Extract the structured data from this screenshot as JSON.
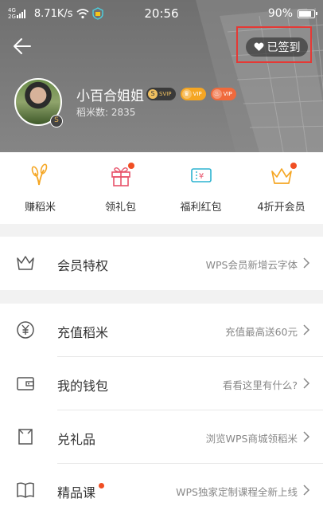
{
  "status_bar": {
    "signal_top": "4G",
    "signal_bottom": "2G",
    "speed": "8.71K/s",
    "time": "20:56",
    "battery": "90%",
    "battery_level": 0.9
  },
  "header": {
    "signin_label": "已签到",
    "username": "小百合姐姐",
    "badges": [
      {
        "glyph": "S",
        "label": "SVIP"
      },
      {
        "glyph": "♛",
        "label": "VIP"
      },
      {
        "glyph": "♨",
        "label": "VIP"
      }
    ],
    "avatar_badge": "S",
    "rice_label": "稻米数: 2835"
  },
  "quick_actions": [
    {
      "label": "赚稻米",
      "icon": "wheat-icon",
      "dot": false
    },
    {
      "label": "领礼包",
      "icon": "gift-icon",
      "dot": true
    },
    {
      "label": "福利红包",
      "icon": "red-envelope-icon",
      "dot": false
    },
    {
      "label": "4折开会员",
      "icon": "crown-icon",
      "dot": true
    }
  ],
  "rows": [
    {
      "title": "会员特权",
      "subtitle": "WPS会员新增云字体",
      "icon": "crown-outline-icon"
    },
    {
      "title": "充值稻米",
      "subtitle": "充值最高送60元",
      "icon": "yen-icon"
    },
    {
      "title": "我的钱包",
      "subtitle": "看看这里有什么?",
      "icon": "wallet-icon"
    },
    {
      "title": "兑礼品",
      "subtitle": "浏览WPS商城领稻米",
      "icon": "bag-icon"
    },
    {
      "title": "精品课",
      "subtitle": "WPS独家定制课程全新上线",
      "icon": "book-icon",
      "dot": true
    }
  ],
  "colors": {
    "accent_orange": "#f5a623",
    "notify_red": "#f04e23",
    "highlight_red": "#e53935",
    "header_gray": "#7c7c7c"
  }
}
